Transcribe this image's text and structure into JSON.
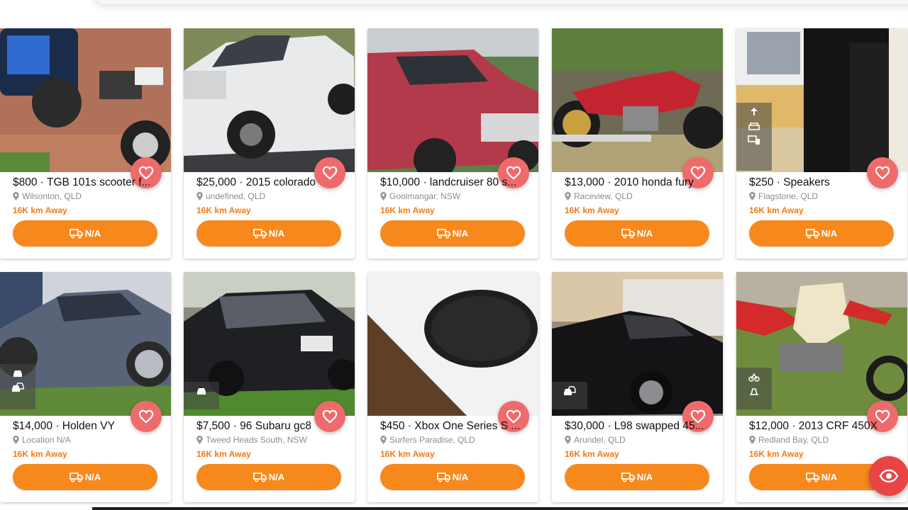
{
  "listings": [
    {
      "title": "$800 · TGB 101s scooter f...",
      "location": "Wilsonton, QLD",
      "distance": "16K km Away",
      "delivery": "N/A"
    },
    {
      "title": "$25,000 · 2015 colorado",
      "location": "undefined, QLD",
      "distance": "16K km Away",
      "delivery": "N/A"
    },
    {
      "title": "$10,000 · landcruiser 80 s...",
      "location": "Goolmangar, NSW",
      "distance": "16K km Away",
      "delivery": "N/A"
    },
    {
      "title": "$13,000 · 2010 honda fury",
      "location": "Raceview, QLD",
      "distance": "16K km Away",
      "delivery": "N/A"
    },
    {
      "title": "$250 · Speakers",
      "location": "Flagstone, QLD",
      "distance": "16K km Away",
      "delivery": "N/A"
    },
    {
      "title": "$14,000 · Holden VY",
      "location": "Location N/A",
      "distance": "16K km Away",
      "delivery": "N/A"
    },
    {
      "title": "$7,500 · 96 Subaru gc8",
      "location": "Tweed Heads South, NSW",
      "distance": "16K km Away",
      "delivery": "N/A"
    },
    {
      "title": "$450 · Xbox One Series S ...",
      "location": "Surfers Paradise, QLD",
      "distance": "16K km Away",
      "delivery": "N/A"
    },
    {
      "title": "$30,000 · L98 swapped 45...",
      "location": "Arundel, QLD",
      "distance": "16K km Away",
      "delivery": "N/A"
    },
    {
      "title": "$12,000 · 2013 CRF 450X",
      "location": "Redland Bay, QLD",
      "distance": "16K km Away",
      "delivery": "N/A"
    }
  ],
  "colors": {
    "accent_orange": "#f7891c",
    "distance_orange": "#f07a1a",
    "favorite_red": "#ef6b6b",
    "fab_red": "#e94545"
  },
  "icons": {
    "location": "map-pin-icon",
    "delivery": "truck-icon",
    "favorite": "heart-icon",
    "fab": "eye-icon"
  }
}
